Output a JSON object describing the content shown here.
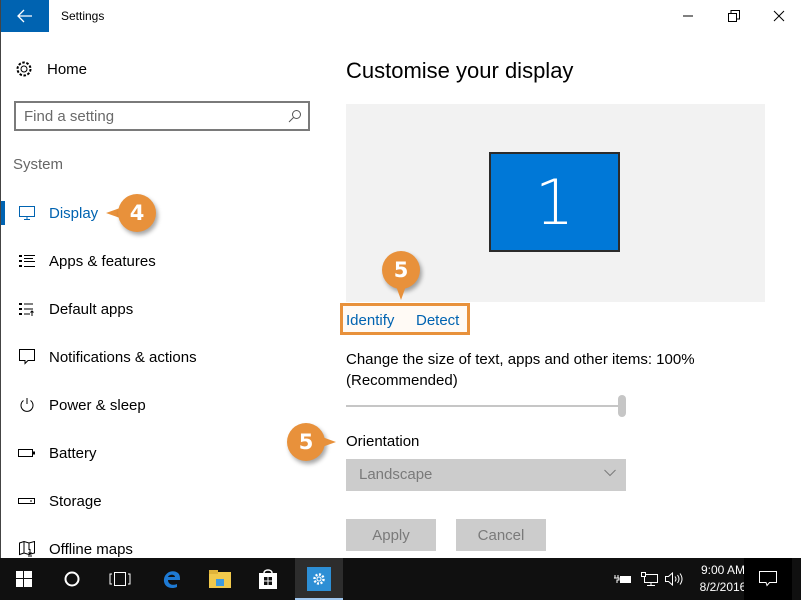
{
  "window": {
    "title": "Settings",
    "controls": {
      "minimize": "minimize-icon",
      "restore": "restore-icon",
      "close": "close-icon"
    }
  },
  "sidebar": {
    "home_label": "Home",
    "search_placeholder": "Find a setting",
    "section_label": "System",
    "items": [
      {
        "label": "Display",
        "icon": "monitor-icon",
        "active": true
      },
      {
        "label": "Apps & features",
        "icon": "list-icon",
        "active": false
      },
      {
        "label": "Default apps",
        "icon": "default-apps-icon",
        "active": false
      },
      {
        "label": "Notifications & actions",
        "icon": "notification-icon",
        "active": false
      },
      {
        "label": "Power & sleep",
        "icon": "power-icon",
        "active": false
      },
      {
        "label": "Battery",
        "icon": "battery-icon",
        "active": false
      },
      {
        "label": "Storage",
        "icon": "storage-icon",
        "active": false
      },
      {
        "label": "Offline maps",
        "icon": "map-icon",
        "active": false
      }
    ]
  },
  "main": {
    "page_title": "Customise your display",
    "monitor_number": "1",
    "identify_label": "Identify",
    "detect_label": "Detect",
    "scale_label": "Change the size of text, apps and other items: 100% (Recommended)",
    "scale_slider_fraction": 1.0,
    "orientation_label": "Orientation",
    "orientation_value": "Landscape",
    "apply_label": "Apply",
    "cancel_label": "Cancel"
  },
  "callouts": {
    "display": "4",
    "identify_detect": "5",
    "orientation": "5"
  },
  "taskbar": {
    "time": "9:00 AM",
    "date": "8/2/2016"
  },
  "colors": {
    "accent": "#0063b1",
    "monitor": "#0078d7",
    "callout": "#e8913b",
    "taskbar": "#101010"
  }
}
